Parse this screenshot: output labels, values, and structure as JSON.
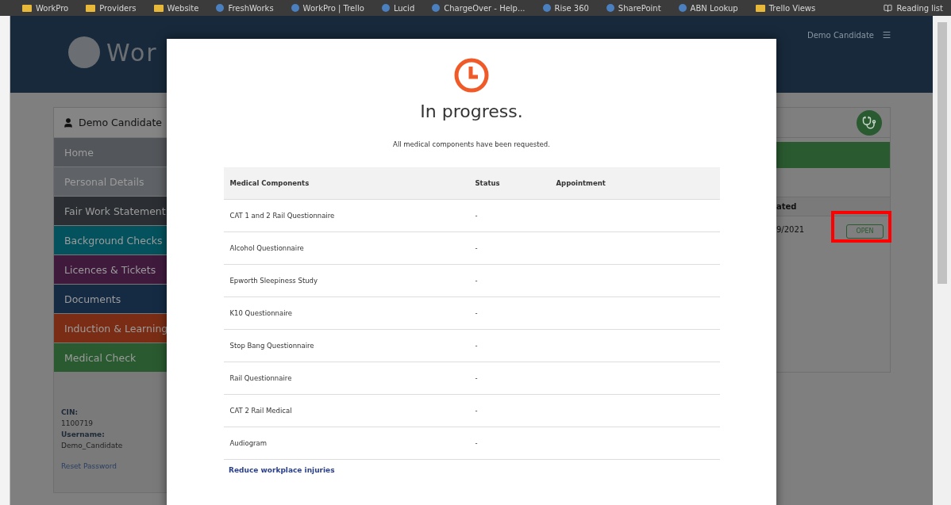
{
  "bookmarks_bar": {
    "items": [
      {
        "label": "WorkPro",
        "kind": "folder"
      },
      {
        "label": "Providers",
        "kind": "folder"
      },
      {
        "label": "Website",
        "kind": "folder"
      },
      {
        "label": "FreshWorks",
        "kind": "site"
      },
      {
        "label": "WorkPro | Trello",
        "kind": "site"
      },
      {
        "label": "Lucid",
        "kind": "site"
      },
      {
        "label": "ChargeOver - Help...",
        "kind": "site"
      },
      {
        "label": "Rise 360",
        "kind": "site"
      },
      {
        "label": "SharePoint",
        "kind": "site"
      },
      {
        "label": "ABN Lookup",
        "kind": "site"
      },
      {
        "label": "Trello Views",
        "kind": "folder"
      }
    ],
    "reading_list": "Reading list"
  },
  "header": {
    "logo_text": "Wor",
    "user": "Demo Candidate"
  },
  "sidebar": {
    "user": "Demo Candidate",
    "items": [
      {
        "label": "Home",
        "color": "#53565a"
      },
      {
        "label": "Personal Details",
        "color": "#5f6266"
      },
      {
        "label": "Fair Work Statement",
        "color": "#2b2e33"
      },
      {
        "label": "Background Checks",
        "color": "#04525d"
      },
      {
        "label": "Licences & Tickets",
        "color": "#3f1a3d"
      },
      {
        "label": "Documents",
        "color": "#152b44"
      },
      {
        "label": "Induction & Learning",
        "color": "#7a2d14"
      },
      {
        "label": "Medical Check",
        "color": "#2a5a30"
      }
    ],
    "info": [
      {
        "label": "CIN:",
        "value": "1100719"
      },
      {
        "label": "Username:",
        "value": "Demo_Candidate"
      }
    ],
    "reset_link": "Reset Password"
  },
  "right_panel": {
    "column_header": "ated",
    "date": "9/2021",
    "open_button": "OPEN",
    "highlighted": true
  },
  "modal": {
    "title": "In progress.",
    "subtitle": "All medical components have been requested.",
    "table": {
      "columns": [
        "Medical Components",
        "Status",
        "Appointment"
      ],
      "rows": [
        [
          "CAT 1 and 2 Rail Questionnaire",
          "-",
          ""
        ],
        [
          "Alcohol Questionnaire",
          "-",
          ""
        ],
        [
          "Epworth Sleepiness Study",
          "-",
          ""
        ],
        [
          "K10 Questionnaire",
          "-",
          ""
        ],
        [
          "Stop Bang Questionnaire",
          "-",
          ""
        ],
        [
          "Rail Questionnaire",
          "-",
          ""
        ],
        [
          "CAT 2 Rail Medical",
          "-",
          ""
        ],
        [
          "Audiogram",
          "-",
          ""
        ]
      ]
    },
    "footer_link": "Reduce workplace injuries"
  }
}
